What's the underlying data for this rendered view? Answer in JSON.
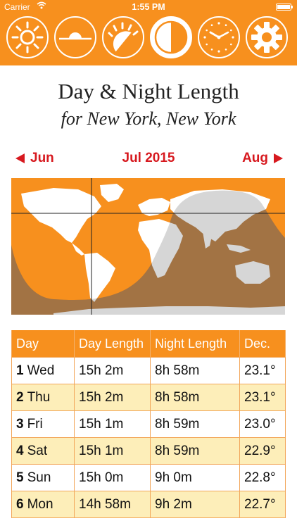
{
  "status": {
    "carrier": "Carrier",
    "time": "1:55 PM"
  },
  "toolbar": {
    "buttons": [
      {
        "icon": "sun-icon"
      },
      {
        "icon": "horizon-icon"
      },
      {
        "icon": "sunrise-icon"
      },
      {
        "icon": "half-moon-icon",
        "active": true
      },
      {
        "icon": "clock-icon"
      },
      {
        "icon": "gear-icon"
      }
    ]
  },
  "header": {
    "title": "Day & Night Length",
    "subtitle": "for New York, New York"
  },
  "nav": {
    "prev": "Jun",
    "current": "Jul 2015",
    "next": "Aug"
  },
  "colors": {
    "accent": "#f7901e",
    "nav_red": "#d7191f",
    "cream": "#fdeeb9",
    "night": "#b06820"
  },
  "table": {
    "headers": [
      "Day",
      "Day Length",
      "Night Length",
      "Dec."
    ],
    "rows": [
      {
        "num": "1",
        "day": "Wed",
        "day_length": "15h 2m",
        "night_length": "8h 58m",
        "dec": "23.1°"
      },
      {
        "num": "2",
        "day": "Thu",
        "day_length": "15h 2m",
        "night_length": "8h 58m",
        "dec": "23.1°"
      },
      {
        "num": "3",
        "day": "Fri",
        "day_length": "15h 1m",
        "night_length": "8h 59m",
        "dec": "23.0°"
      },
      {
        "num": "4",
        "day": "Sat",
        "day_length": "15h 1m",
        "night_length": "8h 59m",
        "dec": "22.9°"
      },
      {
        "num": "5",
        "day": "Sun",
        "day_length": "15h 0m",
        "night_length": "9h 0m",
        "dec": "22.8°"
      },
      {
        "num": "6",
        "day": "Mon",
        "day_length": "14h 58m",
        "night_length": "9h 2m",
        "dec": "22.7°"
      }
    ]
  }
}
